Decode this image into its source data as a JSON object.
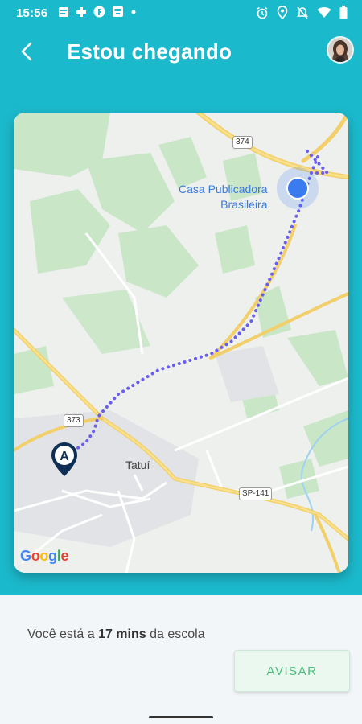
{
  "status_bar": {
    "time": "15:56",
    "left_icons": [
      "gallery-icon",
      "medical-icon",
      "f-app-icon",
      "keyboard-icon",
      "dot-icon"
    ],
    "right_icons": [
      "alarm-icon",
      "location-icon",
      "mute-icon",
      "wifi-icon",
      "battery-icon"
    ]
  },
  "app_bar": {
    "title": "Estou chegando",
    "back_icon": "chevron-left-icon",
    "avatar": "user-avatar"
  },
  "map": {
    "poi_line1": "Casa Publicadora",
    "poi_line2": "Brasileira",
    "city": "Tatuí",
    "shield_374": "374",
    "shield_373": "373",
    "shield_sp141": "SP-141",
    "attribution": "Google",
    "attribution_colors": [
      "#4285F4",
      "#EA4335",
      "#FBBC05",
      "#4285F4",
      "#34A853",
      "#EA4335"
    ],
    "route_color": "#6a5ef0",
    "current_location_color": "#3a7bf0"
  },
  "footer": {
    "eta_prefix": "Você está a ",
    "eta_value": "17 mins",
    "eta_suffix": " da escola",
    "button_label": "AVISAR"
  }
}
